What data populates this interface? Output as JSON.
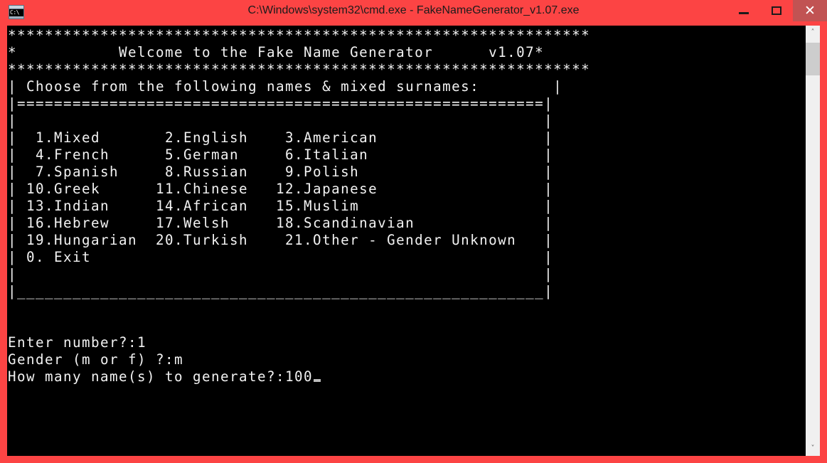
{
  "window": {
    "title": "C:\\Windows\\system32\\cmd.exe - FakeNameGenerator_v1.07.exe",
    "icon_label": "C:\\",
    "frame_color": "#fc4444",
    "close_button_bg": "#c15353",
    "minimize_label": "—",
    "maximize_label": "□",
    "close_label": "✕"
  },
  "console": {
    "background": "#000000",
    "foreground": "#f2f2f2",
    "banner": {
      "top_rule": "***************************************************************",
      "title_line": "*           Welcome to the Fake Name Generator      v1.07*",
      "bottom_rule": "***************************************************************",
      "welcome_text": "Welcome to the Fake Name Generator",
      "version": "v1.07"
    },
    "menu": {
      "header": "| Choose from the following names & mixed surnames:        |",
      "header_text": "Choose from the following names & mixed surnames:",
      "separator": "|=========================================================|",
      "options": [
        {
          "number": "1",
          "label": "Mixed"
        },
        {
          "number": "2",
          "label": "English"
        },
        {
          "number": "3",
          "label": "American"
        },
        {
          "number": "4",
          "label": "French"
        },
        {
          "number": "5",
          "label": "German"
        },
        {
          "number": "6",
          "label": "Italian"
        },
        {
          "number": "7",
          "label": "Spanish"
        },
        {
          "number": "8",
          "label": "Russian"
        },
        {
          "number": "9",
          "label": "Polish"
        },
        {
          "number": "10",
          "label": "Greek"
        },
        {
          "number": "11",
          "label": "Chinese"
        },
        {
          "number": "12",
          "label": "Japanese"
        },
        {
          "number": "13",
          "label": "Indian"
        },
        {
          "number": "14",
          "label": "African"
        },
        {
          "number": "15",
          "label": "Muslim"
        },
        {
          "number": "16",
          "label": "Hebrew"
        },
        {
          "number": "17",
          "label": "Welsh"
        },
        {
          "number": "18",
          "label": "Scandinavian"
        },
        {
          "number": "19",
          "label": "Hungarian"
        },
        {
          "number": "20",
          "label": "Turkish"
        },
        {
          "number": "21",
          "label": "Other - Gender Unknown"
        },
        {
          "number": "0",
          "label": "Exit"
        }
      ],
      "footer_rule": "|_________________________________________________________|"
    },
    "prompts": [
      {
        "label": "Enter number?:",
        "value": "1"
      },
      {
        "label": "Gender (m or f) ?:",
        "value": "m"
      },
      {
        "label": "How many name(s) to generate?:",
        "value": "100"
      }
    ],
    "cursor_visible": true,
    "screen_text": "***************************************************************\n*           Welcome to the Fake Name Generator      v1.07*\n***************************************************************\n| Choose from the following names & mixed surnames:        |\n|=========================================================|\n|                                                         |\n|  1.Mixed       2.English    3.American                  |\n|  4.French      5.German     6.Italian                   |\n|  7.Spanish     8.Russian    9.Polish                    |\n| 10.Greek      11.Chinese   12.Japanese                  |\n| 13.Indian     14.African   15.Muslim                    |\n| 16.Hebrew     17.Welsh     18.Scandinavian              |\n| 19.Hungarian  20.Turkish    21.Other - Gender Unknown   |\n| 0. Exit                                                 |\n|                                                         |\n|_________________________________________________________|\n\n\nEnter number?:1\nGender (m or f) ?:m\nHow many name(s) to generate?:100"
  },
  "scrollbar": {
    "up_arrow": "˄",
    "down_arrow": "˅",
    "thumb_position_percent": 4
  }
}
